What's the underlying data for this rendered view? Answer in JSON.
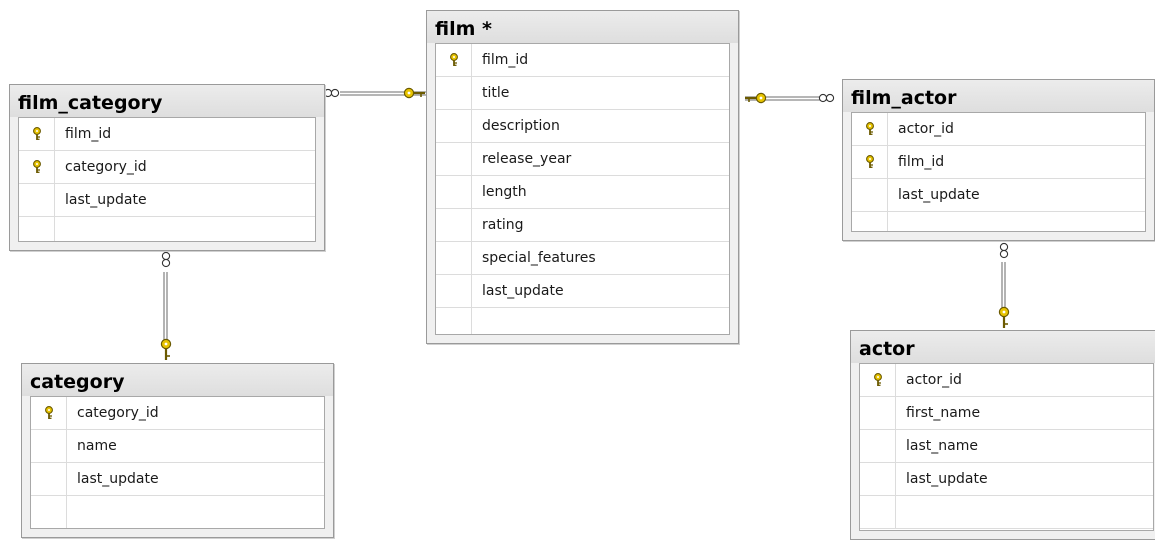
{
  "tables": {
    "film": {
      "title": "film *",
      "columns": [
        {
          "name": "film_id",
          "key": true
        },
        {
          "name": "title",
          "key": false
        },
        {
          "name": "description",
          "key": false
        },
        {
          "name": "release_year",
          "key": false
        },
        {
          "name": "length",
          "key": false
        },
        {
          "name": "rating",
          "key": false
        },
        {
          "name": "special_features",
          "key": false
        },
        {
          "name": "last_update",
          "key": false
        }
      ]
    },
    "film_category": {
      "title": "film_category",
      "columns": [
        {
          "name": "film_id",
          "key": true
        },
        {
          "name": "category_id",
          "key": true
        },
        {
          "name": "last_update",
          "key": false
        }
      ]
    },
    "film_actor": {
      "title": "film_actor",
      "columns": [
        {
          "name": "actor_id",
          "key": true
        },
        {
          "name": "film_id",
          "key": true
        },
        {
          "name": "last_update",
          "key": false
        }
      ]
    },
    "category": {
      "title": "category",
      "columns": [
        {
          "name": "category_id",
          "key": true
        },
        {
          "name": "name",
          "key": false
        },
        {
          "name": "last_update",
          "key": false
        }
      ]
    },
    "actor": {
      "title": "actor",
      "columns": [
        {
          "name": "actor_id",
          "key": true
        },
        {
          "name": "first_name",
          "key": false
        },
        {
          "name": "last_name",
          "key": false
        },
        {
          "name": "last_update",
          "key": false
        }
      ]
    }
  },
  "relationships": [
    {
      "from": "film_category",
      "to": "film",
      "many_end": "film_category",
      "one_end": "film"
    },
    {
      "from": "film_actor",
      "to": "film",
      "many_end": "film_actor",
      "one_end": "film"
    },
    {
      "from": "film_category",
      "to": "category",
      "many_end": "film_category",
      "one_end": "category"
    },
    {
      "from": "film_actor",
      "to": "actor",
      "many_end": "film_actor",
      "one_end": "actor"
    }
  ],
  "colors": {
    "key_icon": "#e8c400",
    "key_outline": "#6b5a00",
    "connector": "#8a8a8a"
  },
  "icons": {
    "primary_key": "key-icon",
    "many_end": "infinity-icon",
    "one_end": "key-icon"
  }
}
